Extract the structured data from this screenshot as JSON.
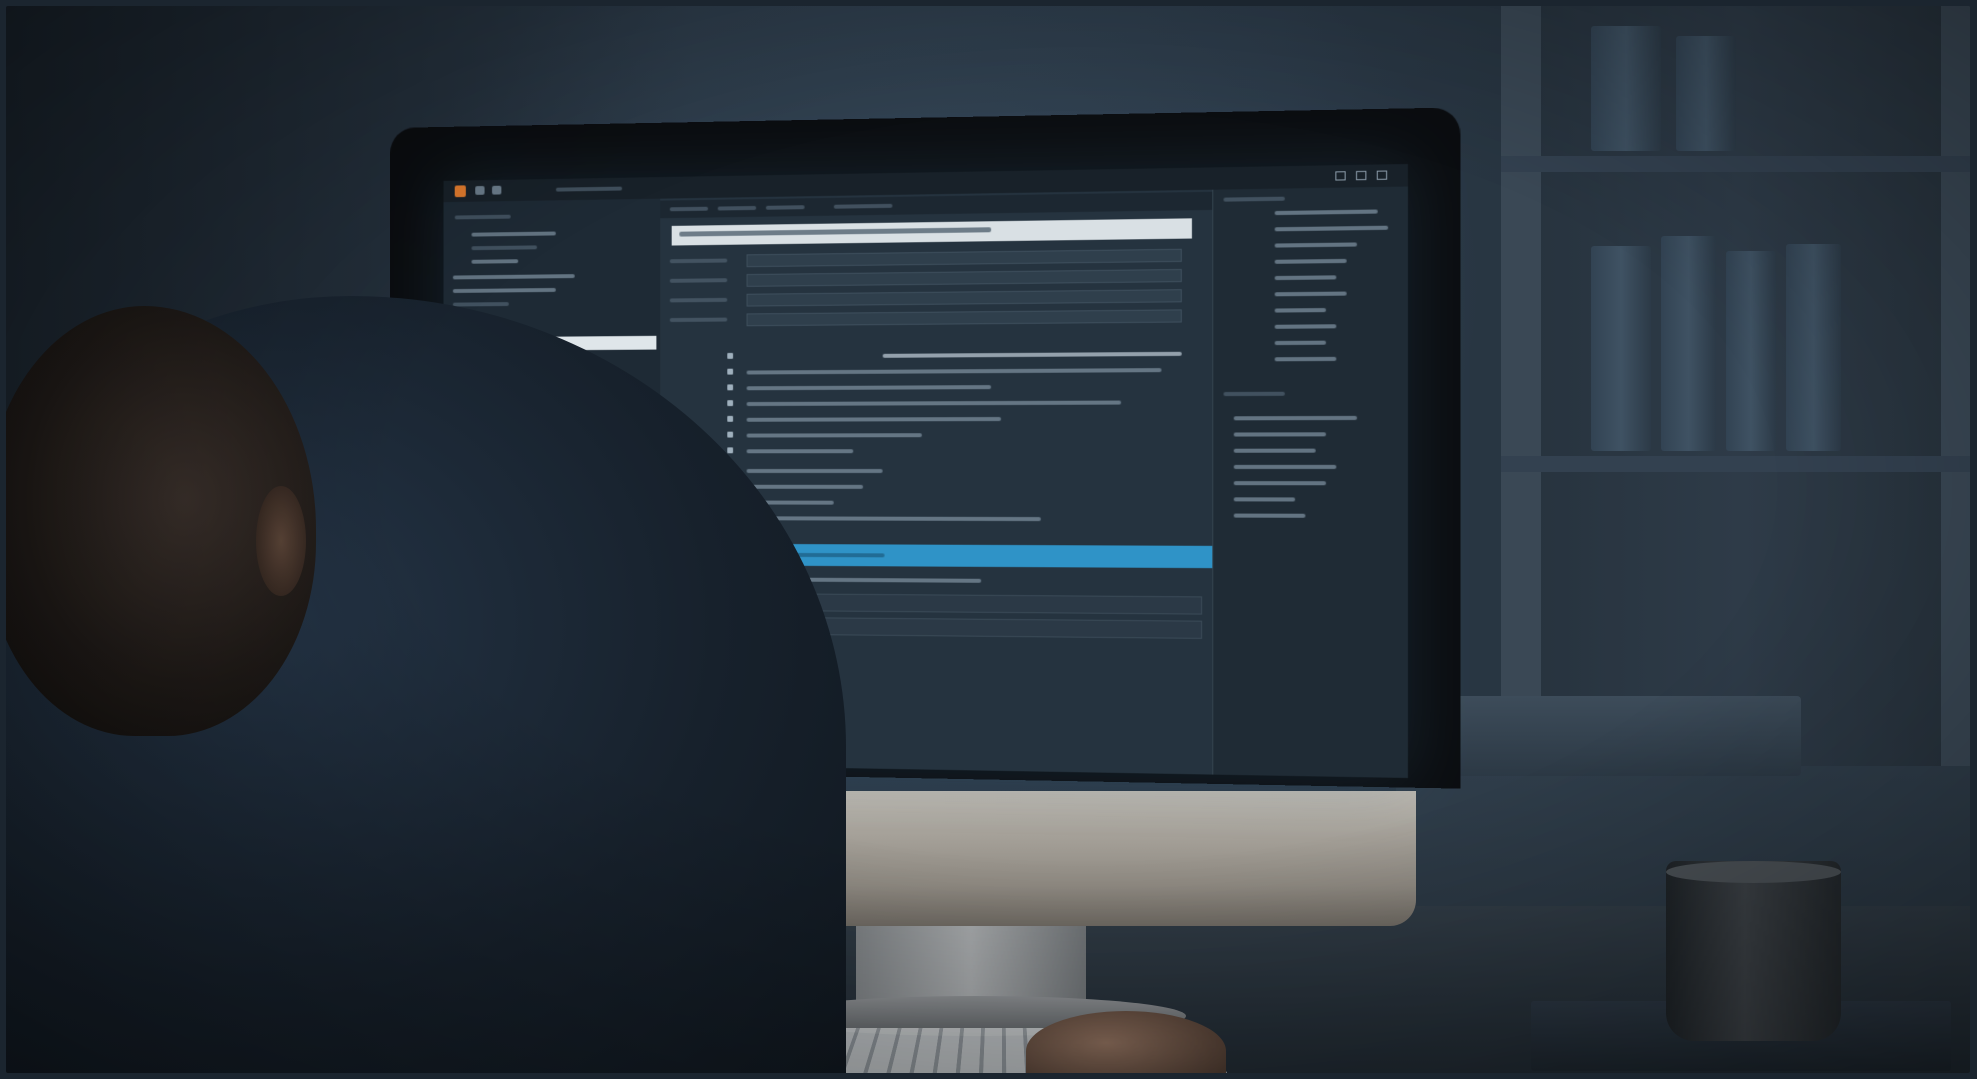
{
  "scene": {
    "description_type": "photo",
    "colors": {
      "screen_background": "#22303c",
      "selection_highlight": "#dfe6ea",
      "accent_bar": "#2f93c7",
      "app_icon": "#e07b2e"
    },
    "icons": [
      "app-icon",
      "folder-icon",
      "settings-icon",
      "minimize-icon",
      "maximize-icon",
      "close-icon"
    ]
  }
}
